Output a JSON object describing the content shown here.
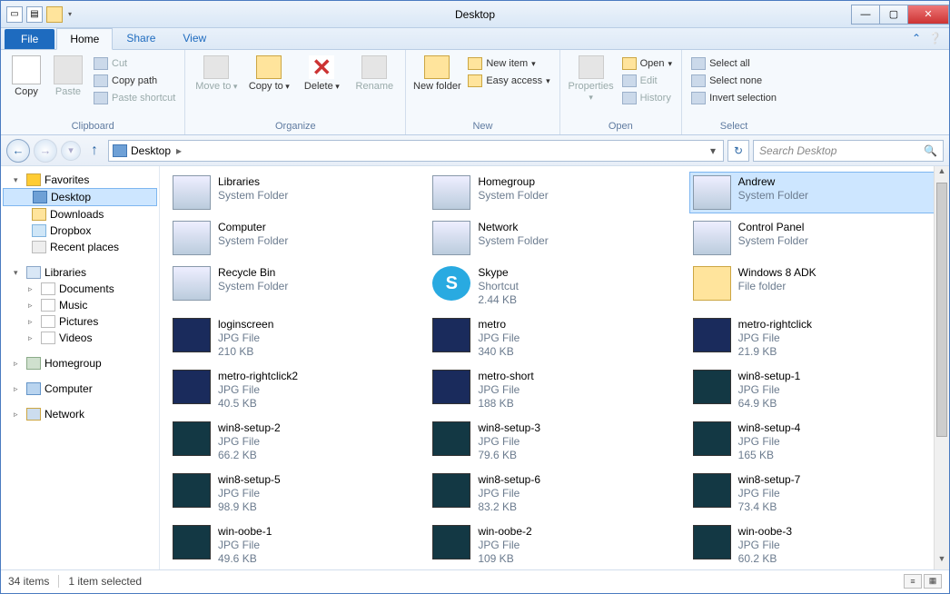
{
  "window": {
    "title": "Desktop"
  },
  "tabs": {
    "file": "File",
    "home": "Home",
    "share": "Share",
    "view": "View"
  },
  "ribbon": {
    "clipboard": {
      "label": "Clipboard",
      "copy": "Copy",
      "paste": "Paste",
      "cut": "Cut",
      "copypath": "Copy path",
      "pasteshortcut": "Paste shortcut"
    },
    "organize": {
      "label": "Organize",
      "moveto": "Move to",
      "copyto": "Copy to",
      "delete": "Delete",
      "rename": "Rename"
    },
    "new": {
      "label": "New",
      "newfolder": "New folder",
      "newitem": "New item",
      "easyaccess": "Easy access"
    },
    "open": {
      "label": "Open",
      "properties": "Properties",
      "open": "Open",
      "edit": "Edit",
      "history": "History"
    },
    "select": {
      "label": "Select",
      "selectall": "Select all",
      "selectnone": "Select none",
      "invert": "Invert selection"
    }
  },
  "address": {
    "location": "Desktop",
    "crumbsep": "▸"
  },
  "search": {
    "placeholder": "Search Desktop"
  },
  "tree": {
    "favorites": "Favorites",
    "desktop": "Desktop",
    "downloads": "Downloads",
    "dropbox": "Dropbox",
    "recent": "Recent places",
    "libraries": "Libraries",
    "documents": "Documents",
    "music": "Music",
    "pictures": "Pictures",
    "videos": "Videos",
    "homegroup": "Homegroup",
    "computer": "Computer",
    "network": "Network"
  },
  "items": [
    {
      "name": "Libraries",
      "sub1": "System Folder",
      "sub2": "",
      "t": "sys"
    },
    {
      "name": "Homegroup",
      "sub1": "System Folder",
      "sub2": "",
      "t": "sys"
    },
    {
      "name": "Andrew",
      "sub1": "System Folder",
      "sub2": "",
      "t": "sys",
      "sel": true
    },
    {
      "name": "Computer",
      "sub1": "System Folder",
      "sub2": "",
      "t": "sys"
    },
    {
      "name": "Network",
      "sub1": "System Folder",
      "sub2": "",
      "t": "sys"
    },
    {
      "name": "Control Panel",
      "sub1": "System Folder",
      "sub2": "",
      "t": "sys"
    },
    {
      "name": "Recycle Bin",
      "sub1": "System Folder",
      "sub2": "",
      "t": "sys"
    },
    {
      "name": "Skype",
      "sub1": "Shortcut",
      "sub2": "2.44 KB",
      "t": "skype"
    },
    {
      "name": "Windows 8 ADK",
      "sub1": "File folder",
      "sub2": "",
      "t": "folder"
    },
    {
      "name": "loginscreen",
      "sub1": "JPG File",
      "sub2": "210 KB",
      "t": "img2"
    },
    {
      "name": "metro",
      "sub1": "JPG File",
      "sub2": "340 KB",
      "t": "img2"
    },
    {
      "name": "metro-rightclick",
      "sub1": "JPG File",
      "sub2": "21.9 KB",
      "t": "img2"
    },
    {
      "name": "metro-rightclick2",
      "sub1": "JPG File",
      "sub2": "40.5 KB",
      "t": "img2"
    },
    {
      "name": "metro-short",
      "sub1": "JPG File",
      "sub2": "188 KB",
      "t": "img2"
    },
    {
      "name": "win8-setup-1",
      "sub1": "JPG File",
      "sub2": "64.9 KB",
      "t": "img"
    },
    {
      "name": "win8-setup-2",
      "sub1": "JPG File",
      "sub2": "66.2 KB",
      "t": "img"
    },
    {
      "name": "win8-setup-3",
      "sub1": "JPG File",
      "sub2": "79.6 KB",
      "t": "img"
    },
    {
      "name": "win8-setup-4",
      "sub1": "JPG File",
      "sub2": "165 KB",
      "t": "img"
    },
    {
      "name": "win8-setup-5",
      "sub1": "JPG File",
      "sub2": "98.9 KB",
      "t": "img"
    },
    {
      "name": "win8-setup-6",
      "sub1": "JPG File",
      "sub2": "83.2 KB",
      "t": "img"
    },
    {
      "name": "win8-setup-7",
      "sub1": "JPG File",
      "sub2": "73.4 KB",
      "t": "img"
    },
    {
      "name": "win-oobe-1",
      "sub1": "JPG File",
      "sub2": "49.6 KB",
      "t": "img"
    },
    {
      "name": "win-oobe-2",
      "sub1": "JPG File",
      "sub2": "109 KB",
      "t": "img"
    },
    {
      "name": "win-oobe-3",
      "sub1": "JPG File",
      "sub2": "60.2 KB",
      "t": "img"
    }
  ],
  "status": {
    "count": "34 items",
    "selected": "1 item selected"
  }
}
